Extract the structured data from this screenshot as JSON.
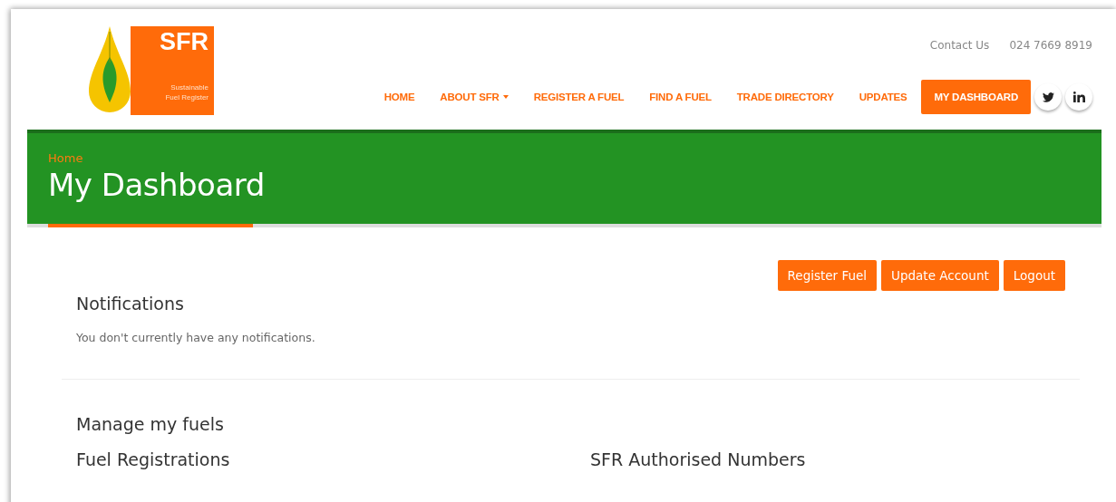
{
  "logo": {
    "title": "SFR",
    "subtitle_1": "Sustainable",
    "subtitle_2": "Fuel Register"
  },
  "top_links": [
    {
      "label": "Contact Us"
    },
    {
      "label": "024 7669 8919"
    }
  ],
  "nav": [
    {
      "label": "HOME",
      "selected": false,
      "dropdown": false
    },
    {
      "label": "ABOUT SFR",
      "selected": false,
      "dropdown": true
    },
    {
      "label": "REGISTER A FUEL",
      "selected": false,
      "dropdown": false
    },
    {
      "label": "FIND A FUEL",
      "selected": false,
      "dropdown": false
    },
    {
      "label": "TRADE DIRECTORY",
      "selected": false,
      "dropdown": false
    },
    {
      "label": "UPDATES",
      "selected": false,
      "dropdown": false
    },
    {
      "label": "MY DASHBOARD",
      "selected": true,
      "dropdown": false
    }
  ],
  "social": [
    {
      "kind": "twitter"
    },
    {
      "kind": "linkedin"
    }
  ],
  "banner": {
    "breadcrumb": "Home",
    "title": "My Dashboard"
  },
  "actions": [
    "Register Fuel",
    "Update Account",
    "Logout"
  ],
  "notifications": {
    "heading": "Notifications",
    "message": "You don't currently have any notifications."
  },
  "manage": {
    "heading": "Manage my fuels",
    "columns": [
      "Fuel Registrations",
      "SFR Authorised Numbers"
    ]
  }
}
